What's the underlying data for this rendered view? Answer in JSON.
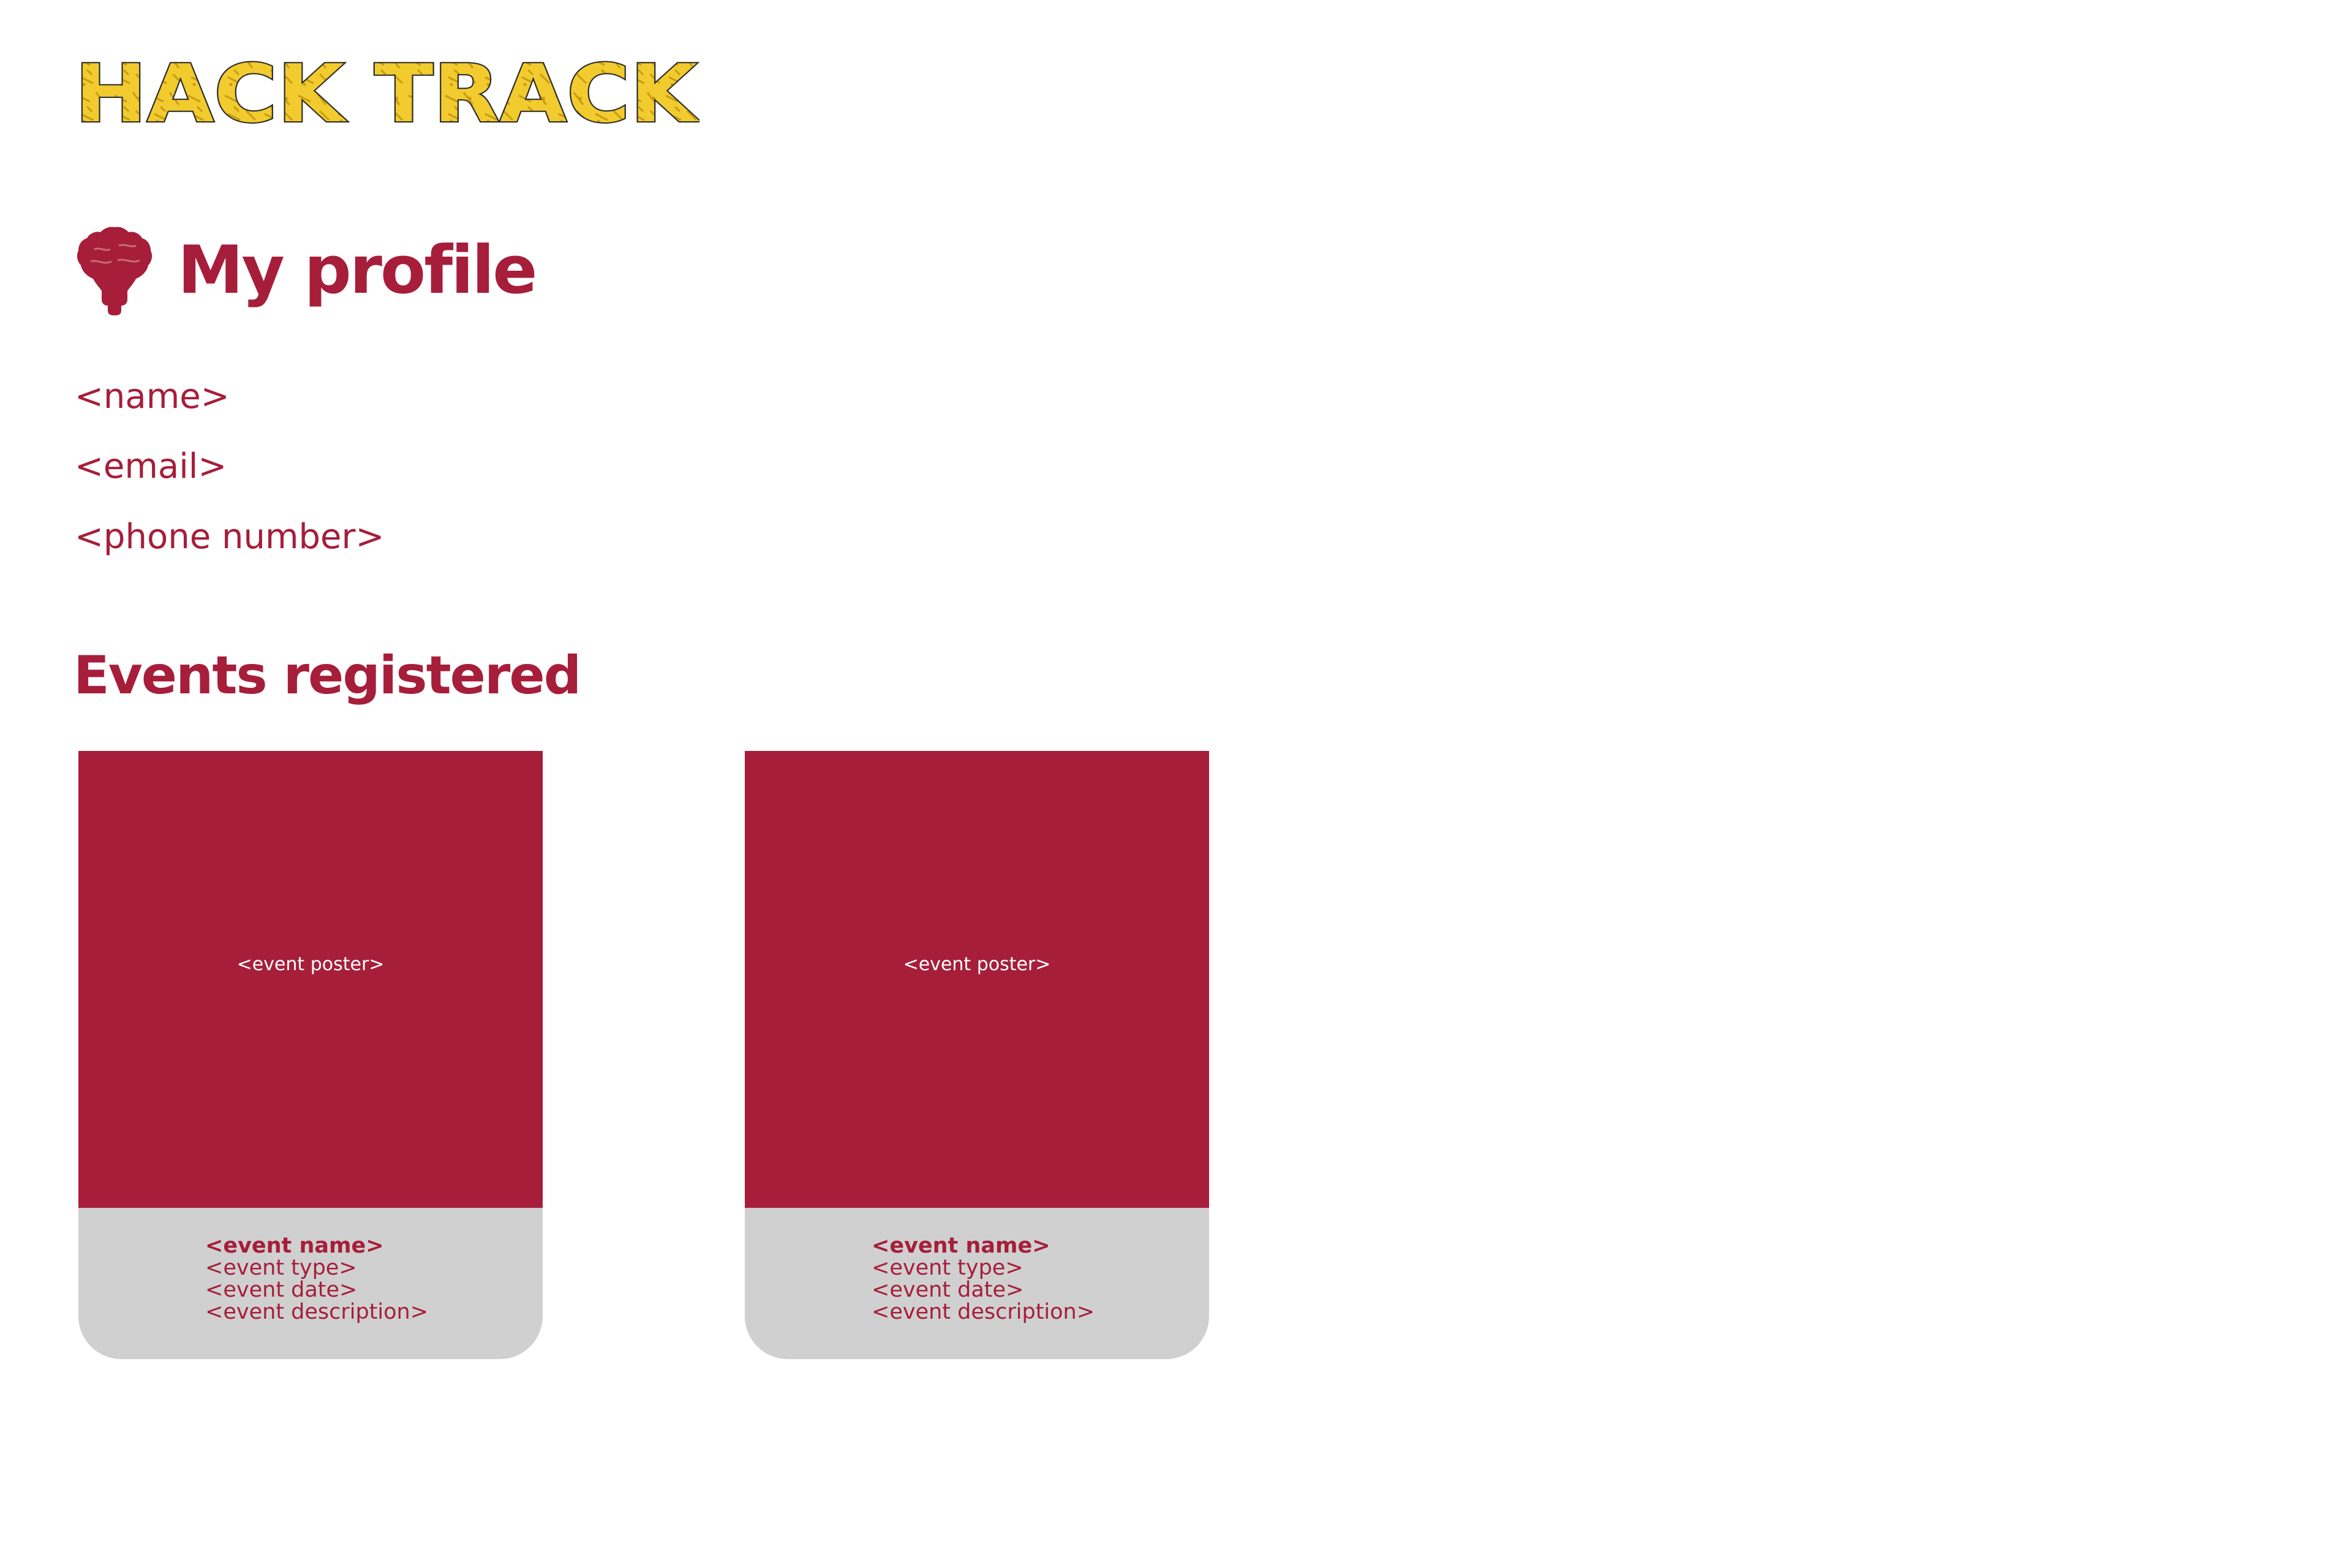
{
  "app": {
    "logo_text": "HACK TRACK"
  },
  "profile": {
    "title": "My profile",
    "name": "<name>",
    "email": "<email>",
    "phone": "<phone number>"
  },
  "events": {
    "title": "Events registered",
    "cards": [
      {
        "poster": "<event poster>",
        "name": "<event name>",
        "type": "<event type>",
        "date": "<event date>",
        "description": "<event description>"
      },
      {
        "poster": "<event poster>",
        "name": "<event name>",
        "type": "<event type>",
        "date": "<event date>",
        "description": "<event description>"
      }
    ]
  },
  "colors": {
    "brand": "#a61e3a",
    "logo_fill": "#f2cb2e",
    "card_footer": "#d0d0d0",
    "background": "#ffffff"
  },
  "icons": {
    "profile": "brain-bulb-icon"
  }
}
